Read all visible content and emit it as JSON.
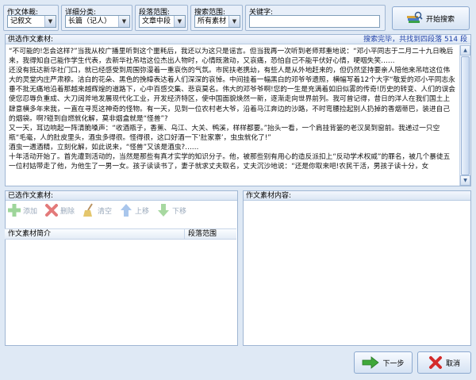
{
  "filters": {
    "genre": {
      "label": "作文体裁:",
      "value": "记叙文"
    },
    "subcategory": {
      "label": "详细分类:",
      "value": "长篇（记人）"
    },
    "paragraph": {
      "label": "段落范围:",
      "value": "文章中段"
    },
    "scope": {
      "label": "搜索范围:",
      "value": "所有素材"
    },
    "keyword": {
      "label": "关键字:",
      "value": ""
    }
  },
  "search_button": "开始搜索",
  "material_panel": {
    "title": "供选作文素材:",
    "status": "搜索完毕，共找到四段落 514 段",
    "paragraphs": [
      "“不可能的!怎会这样?”当我从校广播里听到这个噩耗后，我还以为这只是谣言。但当我再一次听到老师郑重地说：“邓小平同志于二月二十九日晚后来，我得知自己能作学生代表，去新华社吊唁这位杰出人物时，心情既激动，又哀痛，恐怕自己不能平伏好心情，哽咽失笑……",
      "还没有抵达新华社门口，就已经感受到周围弥漫着一重哀伤的气氛。市民扶老携幼，有些人是从外地赶来的，但仍然坚持要亲人陪他来吊唁这位伟大的灵堂内庄严肃穆。洁白的花朵、黑色的挽幛表达着人们深深的哀悼。中间挂着一幅黑白的邓爷爷遗照，横幅写着12个大字“敬爱的邓小平同志永垂不批无痛地沿着那越来越辉煌的道路下，心中百感交集、悲哀莫名。伟大的邓爷爷啊!您的一生是充满着如旧似雾的传奇!历史的转变、人们的误会使您忍辱负重成、大刀阔斧地发展现代化工业，开发经济特区，使中国面貌焕然一新，逐渐走向世界前列。我可曾记得，昔日的洋人在我们国土上肆意横多年来我，一直在寻觅这神奇的怪物。有一天，见到一位农村老大爷，沿着马江奔边的沙路，不时弯腰捡起别人扔掉的香烟蒂巴，装进自己的烟袋。啊?碰到自燃就化解，莫非烟盒就是“怪兽”?",
      "又一天，耳边响起一阵清脆嗓声：“收酒瓶子，香蕉、乌江、大关、鸭溪，样样都要。”抬头一看，一个肩挂背篓的老汉吴到窗前。我递过一只空瓶“毛毫，人的肚皮里头，酒虫多得很。怪得很，这口好酒一下‘肚家寨’，虫虫就化了!”",
      "酒虫一遇酒精，立刻化解，如此说来，“怪兽”又该是酒虫?……",
      "十年活动开始了。首先遭到活动的，当然是那些有真才实学的知识分子。他，被那些别有用心的造反派扣上“反动学术权威”的罪名，被几个暴徒五一位村姑带走了他，为他生了一男一女。孩子读读书了，妻子就求丈夫取名，丈夫沉沙地说：“还是你取来吧!农民干活，男孩子读十分，女"
    ]
  },
  "selected_panel": {
    "title": "已选作文素材:",
    "toolbar": {
      "add": "添加",
      "delete": "删除",
      "clear": "清空",
      "up": "上移",
      "down": "下移"
    },
    "columns": {
      "summary": "作文素材简介",
      "range": "段落范围"
    }
  },
  "content_panel": {
    "title": "作文素材内容:"
  },
  "footer": {
    "next": "下一步",
    "cancel": "取消"
  }
}
